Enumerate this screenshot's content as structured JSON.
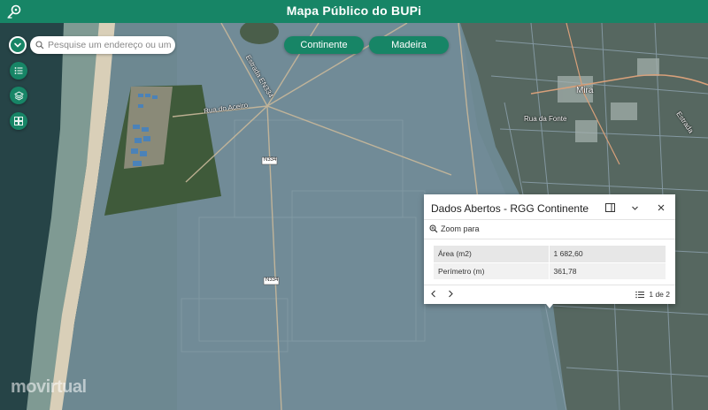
{
  "header": {
    "title": "Mapa Público do BUPi",
    "logo_icon": "map-pin-icon",
    "color": "#178566"
  },
  "search": {
    "placeholder": "Pesquise um endereço ou um lugar",
    "value": ""
  },
  "region_buttons": [
    {
      "label": "Continente"
    },
    {
      "label": "Madeira"
    }
  ],
  "side_tools": [
    {
      "icon": "legend-list-icon"
    },
    {
      "icon": "layers-icon"
    },
    {
      "icon": "basemap-gallery-icon"
    }
  ],
  "map_labels": {
    "road1": "Rua do Aceiro",
    "road2": "Estrada EN334",
    "shield1": "N334",
    "shield2": "N334",
    "town": "Mira",
    "road3": "Rua da Fonte",
    "road4": "Estrada"
  },
  "popup": {
    "title": "Dados Abertos - RGG Continente",
    "zoom_label": "Zoom para",
    "attributes": [
      {
        "field": "Área (m2)",
        "value": "1 682,60"
      },
      {
        "field": "Perímetro (m)",
        "value": "361,78"
      }
    ],
    "pagination": "1 de 2"
  },
  "watermark": "movirtual"
}
